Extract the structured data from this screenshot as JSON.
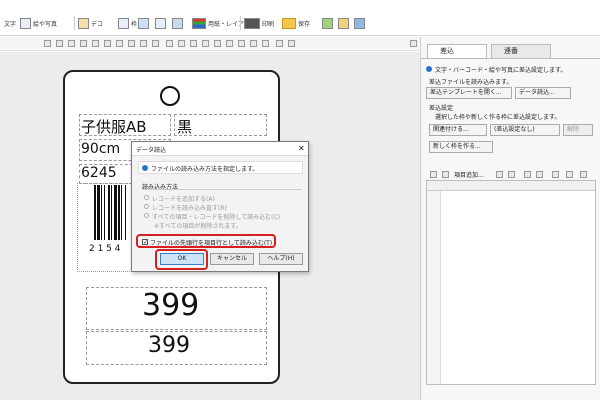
{
  "toolbar": {
    "text_label": "文字",
    "barcode_photo_label": "絵や写真",
    "deco_label": "デコ",
    "frame_label": "枠",
    "layout_label": "用紙・レイアウト",
    "print_label": "印刷",
    "save_label": "保存"
  },
  "tag": {
    "product_name": "子供服AB",
    "color": "黒",
    "size": "90cm",
    "code": "6245",
    "barcode_digits": "2 1 5 4",
    "price_large": "399",
    "price_small": "399"
  },
  "dialog": {
    "title": "データ読込",
    "info_text": "ファイルの読み込み方法を指定します。",
    "group_label": "読み込み方法",
    "option_1": "レコードを追加する(A)",
    "option_2": "レコードを読み込み直す(R)",
    "option_3": "すべての項目・レコードを削除して読み込む(C)",
    "option_3_note": "※すべての項目が削除されます。",
    "first_row_checkbox": "ファイルの先頭行を項目行として読み込む(T)",
    "ok_label": "OK",
    "cancel_label": "キャンセル",
    "help_label": "ヘルプ(H)"
  },
  "panel": {
    "tab_merge": "差込",
    "tab_serial": "連番",
    "info_text": "文字・バーコード・絵や写真に差込設定します。",
    "load_section": "差込ファイルを読み込みます。",
    "template_button": "差込テンプレートを開く...",
    "data_button": "データ読込...",
    "settings_label": "差込設定",
    "settings_hint": "選択した枠や新しく作る枠に差込設定します。",
    "link_button": "関連付ける...",
    "link_status": "(差込設定なし)",
    "unlink_button": "解除",
    "new_frame_button": "新しく枠を作る...",
    "add_item_button": "項目追加..."
  },
  "colors": {
    "highlight": "#d62020",
    "ok_fill": "#cfe3f7",
    "info_blue": "#2b73c9"
  }
}
